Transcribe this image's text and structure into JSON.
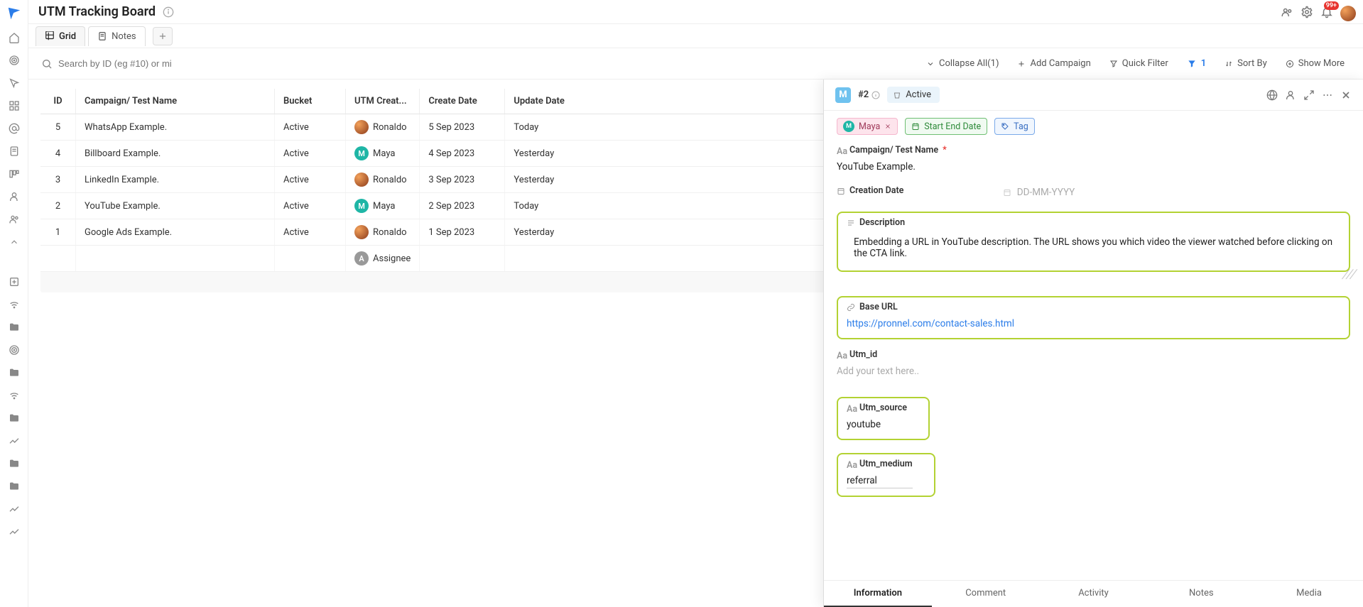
{
  "header": {
    "title": "UTM Tracking Board",
    "notif_badge": "99+"
  },
  "tabs": {
    "grid": "Grid",
    "notes": "Notes"
  },
  "toolbar": {
    "search_placeholder": "Search by ID (eg #10) or mi",
    "collapse": "Collapse All(1)",
    "add_campaign": "Add Campaign",
    "quick_filter": "Quick Filter",
    "filter_count": "1",
    "sort_by": "Sort By",
    "show_more": "Show More"
  },
  "grid": {
    "columns": {
      "id": "ID",
      "name": "Campaign/ Test Name",
      "bucket": "Bucket",
      "creator": "UTM Creat...",
      "create_date": "Create Date",
      "update_date": "Update Date"
    },
    "rows": [
      {
        "id": "5",
        "name": "WhatsApp Example.",
        "bucket": "Active",
        "creator": "Ronaldo",
        "creator_type": "ronaldo",
        "create_date": "5 Sep 2023",
        "update_date": "Today"
      },
      {
        "id": "4",
        "name": "Billboard Example.",
        "bucket": "Active",
        "creator": "Maya",
        "creator_type": "maya",
        "create_date": "4 Sep 2023",
        "update_date": "Yesterday"
      },
      {
        "id": "3",
        "name": "LinkedIn Example.",
        "bucket": "Active",
        "creator": "Ronaldo",
        "creator_type": "ronaldo",
        "create_date": "3 Sep 2023",
        "update_date": "Yesterday"
      },
      {
        "id": "2",
        "name": "YouTube Example.",
        "bucket": "Active",
        "creator": "Maya",
        "creator_type": "maya",
        "create_date": "2 Sep 2023",
        "update_date": "Today"
      },
      {
        "id": "1",
        "name": "Google Ads Example.",
        "bucket": "Active",
        "creator": "Ronaldo",
        "creator_type": "ronaldo",
        "create_date": "1 Sep 2023",
        "update_date": "Yesterday"
      }
    ],
    "footer_assignee": "Assignee"
  },
  "panel": {
    "avatar_letter": "M",
    "id": "#2",
    "status": "Active",
    "chips": {
      "maya": "Maya",
      "date": "Start End Date",
      "tag": "Tag"
    },
    "fields": {
      "name_label": "Campaign/ Test Name",
      "name_value": "YouTube Example.",
      "creation_date_label": "Creation Date",
      "creation_date_placeholder": "DD-MM-YYYY",
      "description_label": "Description",
      "description_value": "Embedding a URL in YouTube description. The URL shows you which video the viewer watched before clicking on the CTA link.",
      "base_url_label": "Base URL",
      "base_url_value": "https://pronnel.com/contact-sales.html",
      "utm_id_label": "Utm_id",
      "utm_id_placeholder": "Add your text here..",
      "utm_source_label": "Utm_source",
      "utm_source_value": "youtube",
      "utm_medium_label": "Utm_medium",
      "utm_medium_value": "referral"
    },
    "tabs": {
      "information": "Information",
      "comment": "Comment",
      "activity": "Activity",
      "notes": "Notes",
      "media": "Media"
    }
  }
}
